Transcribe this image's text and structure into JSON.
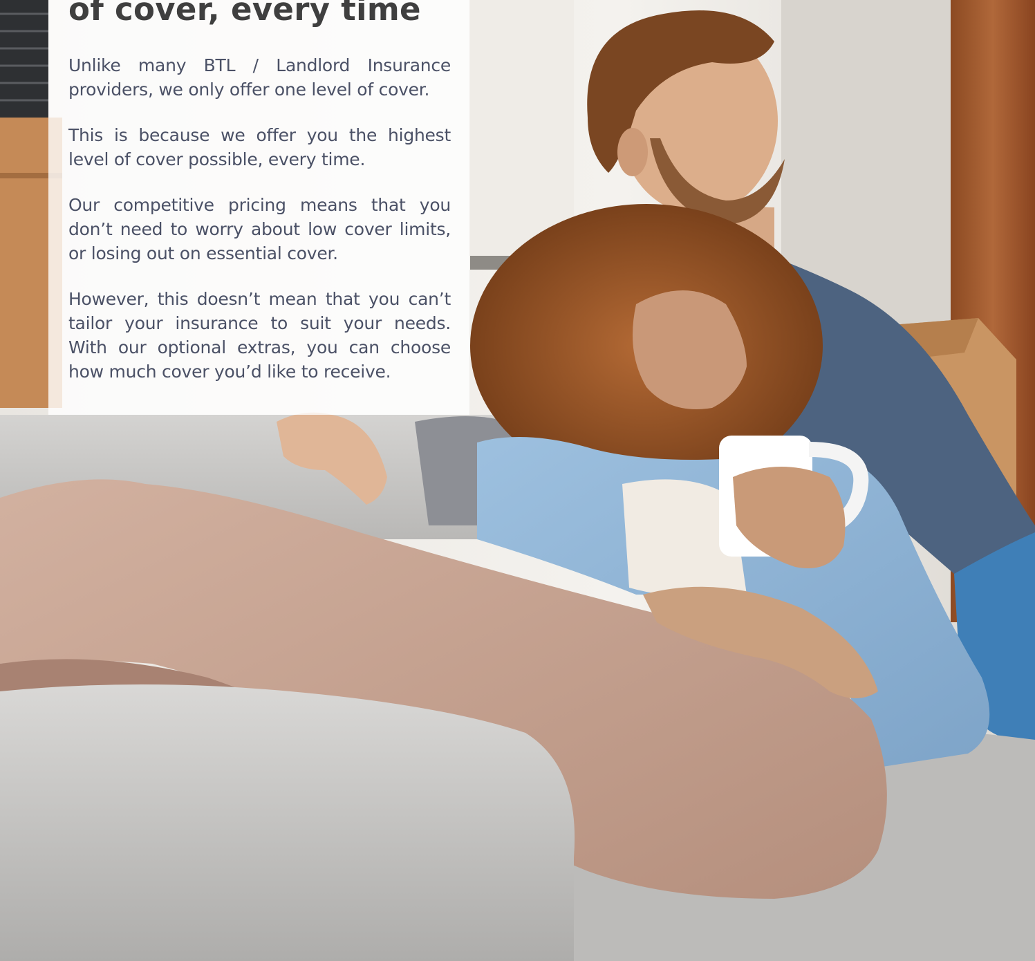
{
  "section": {
    "heading": "of cover, every time",
    "paragraphs": [
      "Unlike many BTL / Landlord Insurance providers, we only offer one level of cover.",
      "This is because we offer you the highest level of cover possible, every time.",
      "Our competitive pricing means that you don’t need to worry about low cover limits, or losing out on essential cover.",
      "However, this doesn’t mean that you can’t tailor your insurance to suit your needs. With our optional extras, you can choose how much cover you’d like to receive."
    ]
  },
  "colors": {
    "heading": "#3f3f3f",
    "body_text": "#4b5166",
    "panel_background": "#ffffff",
    "sofa": "#c9c8c6",
    "wood_wall": "#a25a2c",
    "trousers": "#c8a493",
    "denim_shirt": "#8fb4d6"
  }
}
